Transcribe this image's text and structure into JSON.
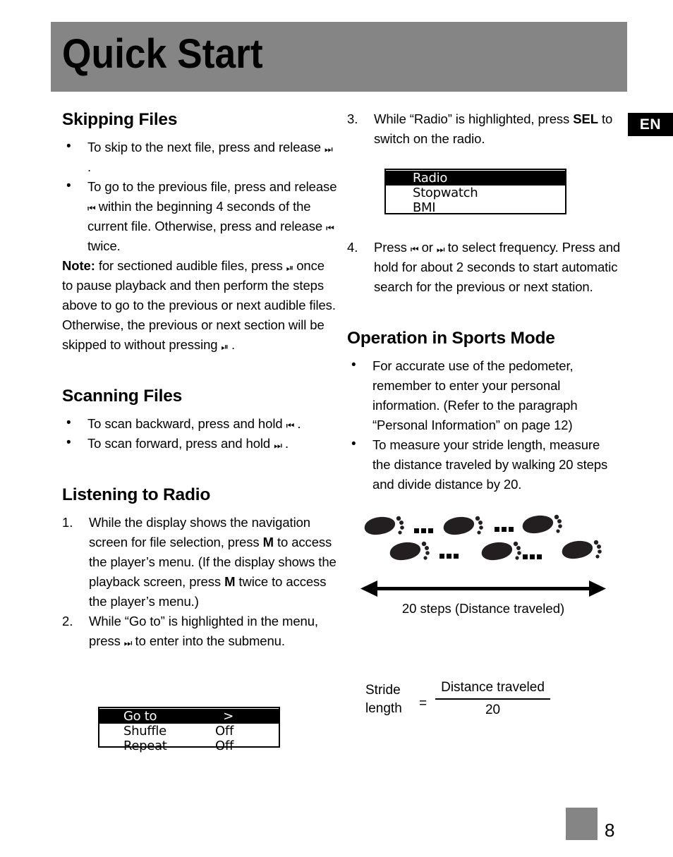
{
  "header": {
    "title": "Quick Start",
    "banner_color": "#858585"
  },
  "language_badge": {
    "label": "EN",
    "bg_color": "#000000",
    "text_color": "#ffffff"
  },
  "left_column": {
    "section_skipping": {
      "heading": "Skipping Files",
      "bullets": [
        {
          "before": "To skip to the next file, press and release",
          "icon": "next-track-icon",
          "glyph": "⏭",
          "after": "."
        },
        {
          "before": "To go to the previous file, press and release",
          "icon": "previous-track-icon",
          "glyph": "⏮",
          "after": "within the beginning 4 seconds of the current file. Otherwise, press and release",
          "icon2": "previous-track-icon",
          "glyph2": "⏮",
          "after2": "twice."
        }
      ],
      "note_label": "Note:",
      "note_part1": "for sectioned audible files, press",
      "note_icon1": "play-pause-icon",
      "note_glyph1": "⏯",
      "note_part2": "once to pause playback and then perform the steps above to go to the previous or next audible files. Otherwise, the previous or next section will be skipped to without pressing",
      "note_icon2": "play-pause-icon",
      "note_glyph2": "⏯",
      "note_part3": "."
    },
    "section_scanning": {
      "heading": "Scanning Files",
      "bullets": [
        {
          "before": "To scan backward, press and hold",
          "icon": "rewind-icon",
          "glyph": "⏮",
          "after": "."
        },
        {
          "before": "To scan forward, press and hold",
          "icon": "fast-forward-icon",
          "glyph": "⏭",
          "after": "."
        }
      ]
    },
    "section_listening": {
      "heading": "Listening to Radio",
      "step1_part1": "While the display shows the navigation screen for file selection, press",
      "step1_key1": "M",
      "step1_part2": "to access the player’s menu. (If the display shows the playback screen, press",
      "step1_key2": "M",
      "step1_part3": "twice to access the player’s menu.)",
      "step2_part1": "While “Go to” is highlighted in the menu, press",
      "step2_icon": "next-track-icon",
      "step2_glyph": "⏭",
      "step2_part2": "to enter into the submenu."
    },
    "lcd_menu": {
      "name": "player-menu-screen",
      "rows": [
        {
          "label": "Go to",
          "value": ">",
          "highlighted": true
        },
        {
          "label": "Shuffle",
          "value": "Off",
          "highlighted": false
        },
        {
          "label": "Repeat",
          "value": "Off",
          "highlighted": false
        }
      ]
    }
  },
  "right_column": {
    "step3_part1": "While “Radio” is highlighted, press",
    "step3_key": "SEL",
    "step3_part2": "to switch on the radio.",
    "lcd_sports": {
      "name": "sports-mode-screen",
      "rows": [
        {
          "label": "Radio",
          "value": "",
          "highlighted": true
        },
        {
          "label": "Stopwatch",
          "value": "",
          "highlighted": false
        },
        {
          "label": "BMI",
          "value": "",
          "highlighted": false
        }
      ]
    },
    "step4_part1": "Press",
    "step4_icon1": "previous-track-icon",
    "step4_glyph1": "⏮",
    "step4_part2": "or",
    "step4_icon2": "next-track-icon",
    "step4_glyph2": "⏭",
    "step4_part3": "to select frequency. Press and hold for about 2 seconds to start automatic search for the previous or next station.",
    "section_sports": {
      "heading": "Operation in Sports Mode",
      "bullets": [
        "For accurate use of the pedometer, remember to enter  your personal information. (Refer to the paragraph “Personal Information” on page 12)",
        "To measure your stride length, measure the distance traveled by walking 20 steps and divide distance by 20."
      ]
    },
    "footprint_diagram": {
      "name": "footprints-distance-diagram",
      "caption": "20 steps (Distance traveled)",
      "ellipsis": "...",
      "footprint_count": 6,
      "ellipsis_count": 4
    },
    "stride_formula": {
      "label_line1": "Stride",
      "label_line2": "length",
      "equals": "=",
      "numerator": "Distance traveled",
      "denominator": "20"
    }
  },
  "footer": {
    "page_number": "8",
    "swatch_color": "#858585"
  }
}
